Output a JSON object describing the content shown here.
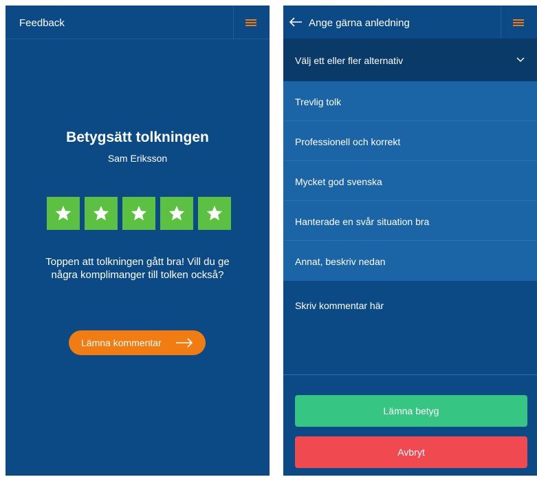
{
  "left_screen": {
    "header": {
      "title": "Feedback",
      "menu_icon": "hamburger-menu-icon"
    },
    "rating": {
      "title": "Betygsätt tolkningen",
      "interpreter_name": "Sam Eriksson",
      "stars": 5,
      "max_stars": 5,
      "star_color": "#5cc142"
    },
    "prompt": "Toppen att tolkningen gått bra! Vill du ge några komplimanger till tolken också?",
    "comment_button": {
      "label": "Lämna kommentar",
      "icon": "arrow-right-icon",
      "color": "#f07c12"
    }
  },
  "right_screen": {
    "header": {
      "title": "Ange gärna anledning",
      "back_icon": "arrow-left-icon",
      "menu_icon": "hamburger-menu-icon"
    },
    "dropdown": {
      "label": "Välj ett eller fler alternativ",
      "icon": "chevron-down-icon"
    },
    "options": [
      "Trevlig tolk",
      "Professionell och korrekt",
      "Mycket god svenska",
      "Hanterade en svår situation bra",
      "Annat, beskriv nedan"
    ],
    "comment_placeholder": "Skriv kommentar här",
    "submit_button": {
      "label": "Lämna betyg",
      "color": "#37c584"
    },
    "cancel_button": {
      "label": "Avbryt",
      "color": "#f04a50"
    }
  },
  "colors": {
    "background": "#0c4a86",
    "accent": "#f07c12"
  }
}
